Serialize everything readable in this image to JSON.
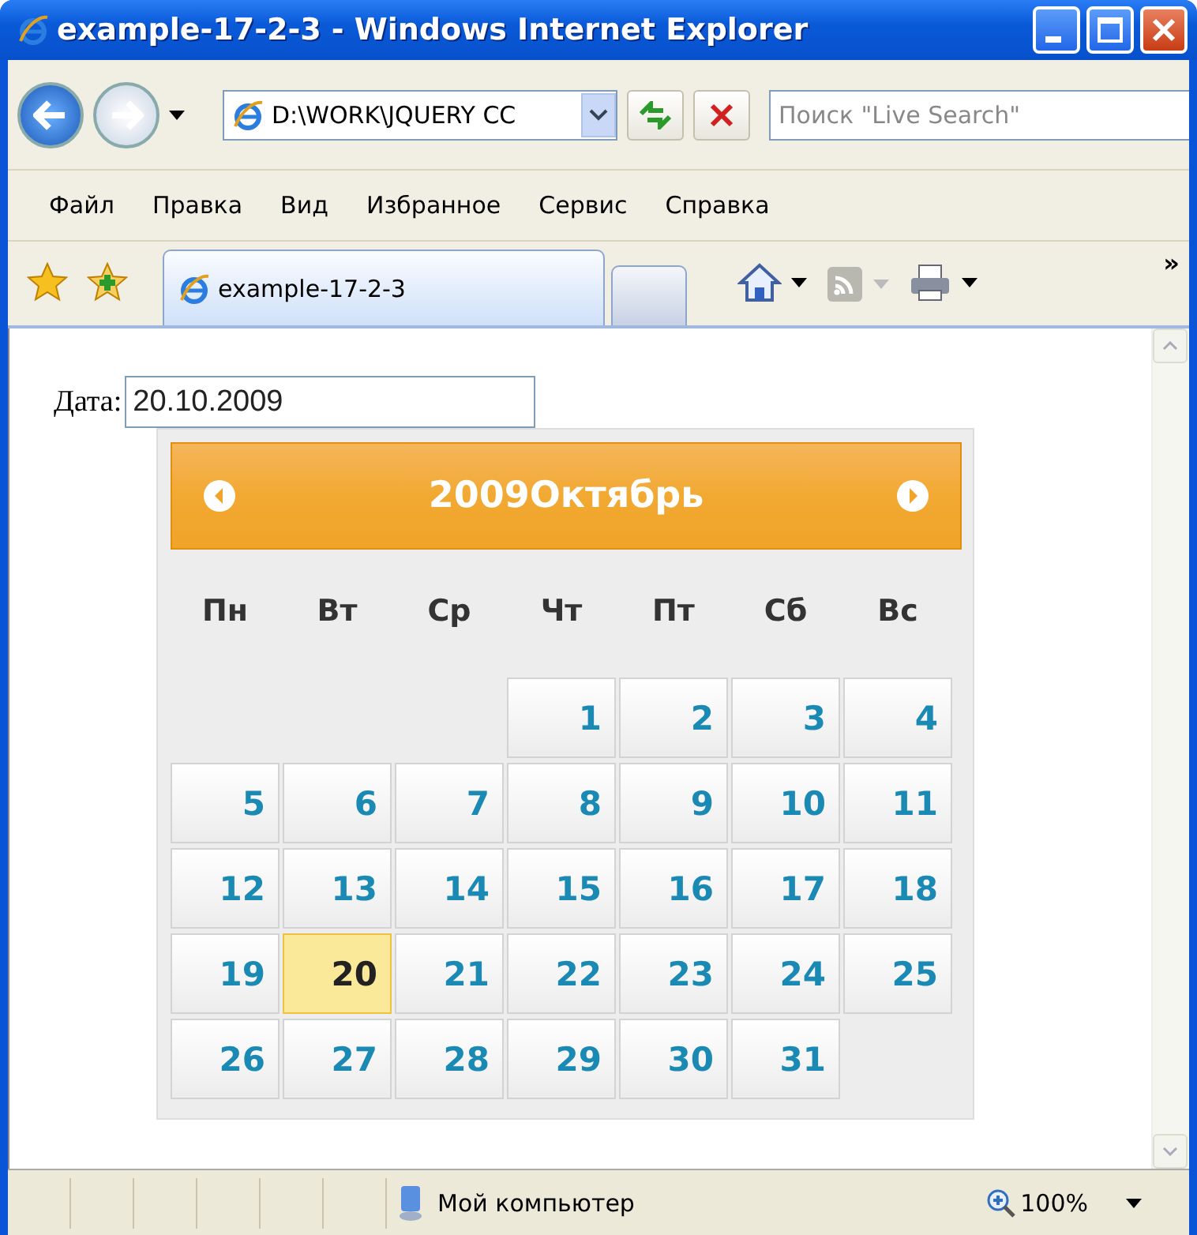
{
  "window": {
    "title": "example-17-2-3 - Windows Internet Explorer"
  },
  "address_bar": {
    "value": "D:\\WORK\\JQUERY CC"
  },
  "search": {
    "placeholder": "Поиск \"Live Search\""
  },
  "menu": [
    "Файл",
    "Правка",
    "Вид",
    "Избранное",
    "Сервис",
    "Справка"
  ],
  "tabs": [
    {
      "label": "example-17-2-3",
      "selected": true
    }
  ],
  "toolbar_overflow": "»",
  "page": {
    "field_label": "Дата:",
    "date_value": "20.10.2009"
  },
  "calendar": {
    "title": "2009Октябрь",
    "weekdays": [
      "Пн",
      "Вт",
      "Ср",
      "Чт",
      "Пт",
      "Сб",
      "Вс"
    ],
    "weeks": [
      [
        {
          "kind": "empty"
        },
        {
          "kind": "empty"
        },
        {
          "kind": "empty"
        },
        {
          "day": "1",
          "selected": false
        },
        {
          "day": "2",
          "selected": false
        },
        {
          "day": "3",
          "selected": false
        },
        {
          "day": "4",
          "selected": false
        }
      ],
      [
        {
          "day": "5",
          "selected": false
        },
        {
          "day": "6",
          "selected": false
        },
        {
          "day": "7",
          "selected": false
        },
        {
          "day": "8",
          "selected": false
        },
        {
          "day": "9",
          "selected": false
        },
        {
          "day": "10",
          "selected": false
        },
        {
          "day": "11",
          "selected": false
        }
      ],
      [
        {
          "day": "12",
          "selected": false
        },
        {
          "day": "13",
          "selected": false
        },
        {
          "day": "14",
          "selected": false
        },
        {
          "day": "15",
          "selected": false
        },
        {
          "day": "16",
          "selected": false
        },
        {
          "day": "17",
          "selected": false
        },
        {
          "day": "18",
          "selected": false
        }
      ],
      [
        {
          "day": "19",
          "selected": false
        },
        {
          "day": "20",
          "selected": true
        },
        {
          "day": "21",
          "selected": false
        },
        {
          "day": "22",
          "selected": false
        },
        {
          "day": "23",
          "selected": false
        },
        {
          "day": "24",
          "selected": false
        },
        {
          "day": "25",
          "selected": false
        }
      ],
      [
        {
          "day": "26",
          "selected": false
        },
        {
          "day": "27",
          "selected": false
        },
        {
          "day": "28",
          "selected": false
        },
        {
          "day": "29",
          "selected": false
        },
        {
          "day": "30",
          "selected": false
        },
        {
          "day": "31",
          "selected": false
        },
        {
          "kind": "empty"
        }
      ]
    ]
  },
  "status_bar": {
    "zone": "Мой компьютер",
    "zoom": "100%"
  }
}
